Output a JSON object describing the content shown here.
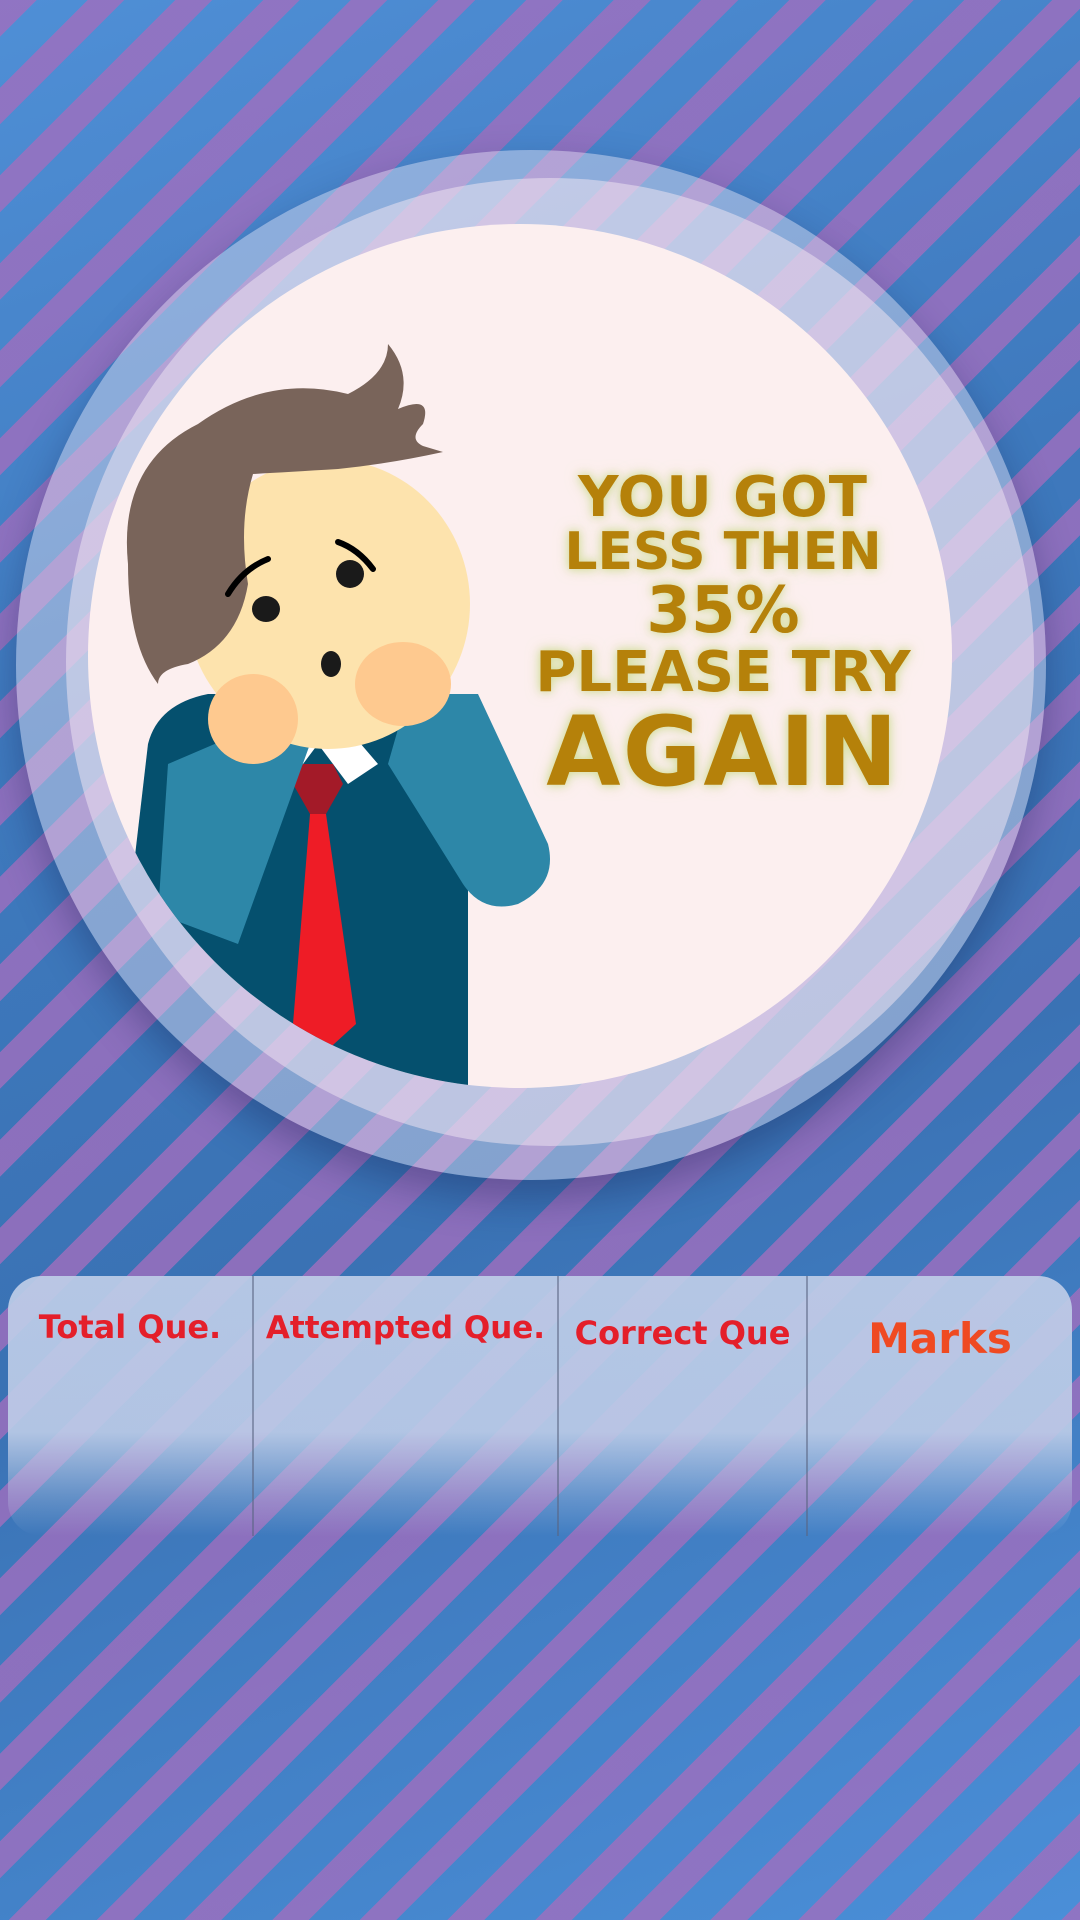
{
  "result": {
    "line1": "YOU GOT",
    "line2_prefix": "LESS THEN ",
    "line2_percent": "35%",
    "line3": "PLEASE TRY",
    "line4": "AGAIN"
  },
  "stats": {
    "total_label": "Total Que.",
    "attempted_label": "Attempted Que.",
    "correct_label": "Correct Que",
    "marks_label": "Marks"
  },
  "colors": {
    "message_text": "#b5810a",
    "label_red": "#e41f2a",
    "marks_orange": "#ef4a22",
    "background_blue": "#3e79bd",
    "stripe_purple": "#a06ebe",
    "disc": "#fcefef"
  },
  "icons": {
    "character": "worried-businessman-illustration"
  }
}
